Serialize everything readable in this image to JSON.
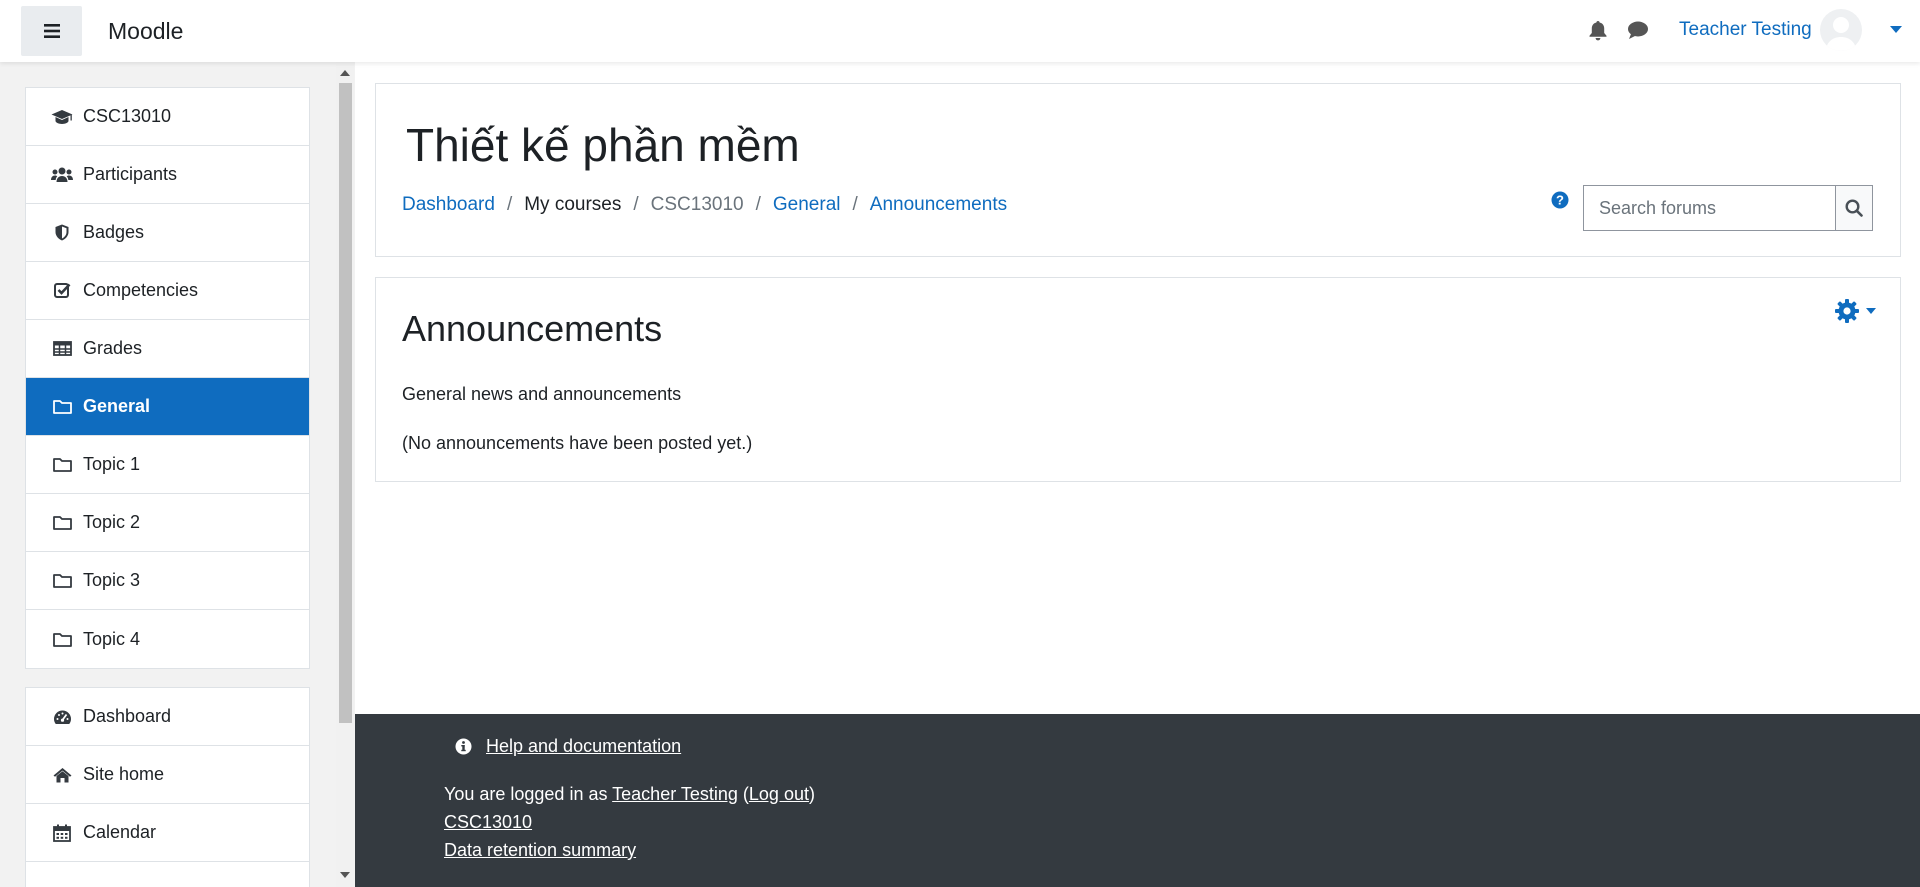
{
  "app": {
    "brand": "Moodle"
  },
  "header": {
    "user_name": "Teacher Testing"
  },
  "sidebar": {
    "course_items": [
      {
        "label": "CSC13010",
        "icon": "graduation-cap-icon"
      },
      {
        "label": "Participants",
        "icon": "users-icon"
      },
      {
        "label": "Badges",
        "icon": "shield-icon"
      },
      {
        "label": "Competencies",
        "icon": "check-square-icon"
      },
      {
        "label": "Grades",
        "icon": "table-icon"
      },
      {
        "label": "General",
        "icon": "folder-icon",
        "active": true
      },
      {
        "label": "Topic 1",
        "icon": "folder-icon"
      },
      {
        "label": "Topic 2",
        "icon": "folder-icon"
      },
      {
        "label": "Topic 3",
        "icon": "folder-icon"
      },
      {
        "label": "Topic 4",
        "icon": "folder-icon"
      }
    ],
    "site_items": [
      {
        "label": "Dashboard",
        "icon": "dashboard-icon"
      },
      {
        "label": "Site home",
        "icon": "home-icon"
      },
      {
        "label": "Calendar",
        "icon": "calendar-icon"
      }
    ]
  },
  "page": {
    "title": "Thiết kế phần mềm",
    "breadcrumb": {
      "dashboard": "Dashboard",
      "my_courses": "My courses",
      "course": "CSC13010",
      "section": "General",
      "forum": "Announcements",
      "separator": "/"
    },
    "search": {
      "placeholder": "Search forums"
    }
  },
  "forum": {
    "title": "Announcements",
    "description": "General news and announcements",
    "empty_message": "(No announcements have been posted yet.)"
  },
  "footer": {
    "help_link": "Help and documentation",
    "logged_in_prefix": "You are logged in as ",
    "user_link": "Teacher Testing",
    "open_paren": " (",
    "logout_link": "Log out",
    "close_paren": ")",
    "course_link": "CSC13010",
    "retention_link": "Data retention summary"
  },
  "colors": {
    "primary": "#0f6cbf",
    "footer_bg": "#343a40",
    "drawer_bg": "#f2f2f2"
  }
}
